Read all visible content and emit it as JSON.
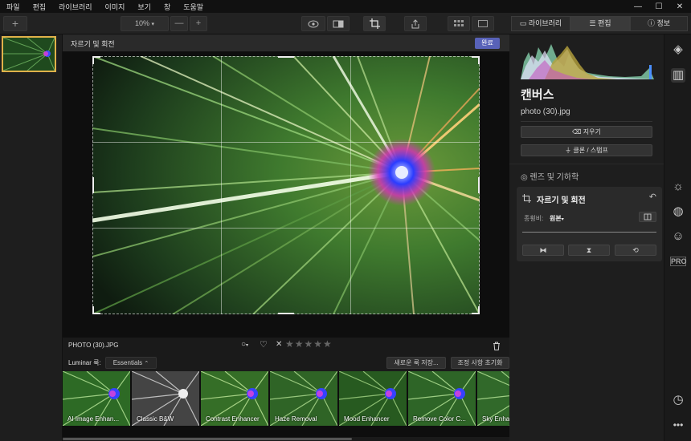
{
  "menu": [
    "파일",
    "편집",
    "라이브러리",
    "이미지",
    "보기",
    "창",
    "도움말"
  ],
  "window_controls": {
    "minimize": "—",
    "maximize": "☐",
    "close": "✕"
  },
  "toolbar": {
    "add": "+",
    "zoom": "10%",
    "zoom_out": "—",
    "zoom_in": "+"
  },
  "right_tabs": {
    "library": "라이브러리",
    "edit": "편집",
    "info": "정보"
  },
  "crop_header": {
    "title": "자르기 및 회전",
    "done": "완료"
  },
  "photo_info": {
    "filename": "PHOTO (30).JPG",
    "flag": "○",
    "stars": "★★★★★",
    "reject": "✕"
  },
  "presets_bar": {
    "label": "Luminar 룩:",
    "category": "Essentials",
    "save_look": "새로운 룩 저장...",
    "reset": "조정 사항 초기화"
  },
  "presets": [
    "AI Image Enhan...",
    "Classic B&W",
    "Contrast Enhancer",
    "Haze Removal",
    "Mood Enhancer",
    "Remove Color C...",
    "Sky Enha"
  ],
  "panel": {
    "canvas_title": "캔버스",
    "photo_name": "photo (30).jpg",
    "erase": "지우기",
    "clone": "클론 / 스탬프",
    "lens": "렌즈 및 기하학",
    "crop_title": "자르기 및 회전",
    "aspect_label": "종횡비:",
    "aspect_value": "원본"
  },
  "rail": {
    "pro": "PRO"
  }
}
